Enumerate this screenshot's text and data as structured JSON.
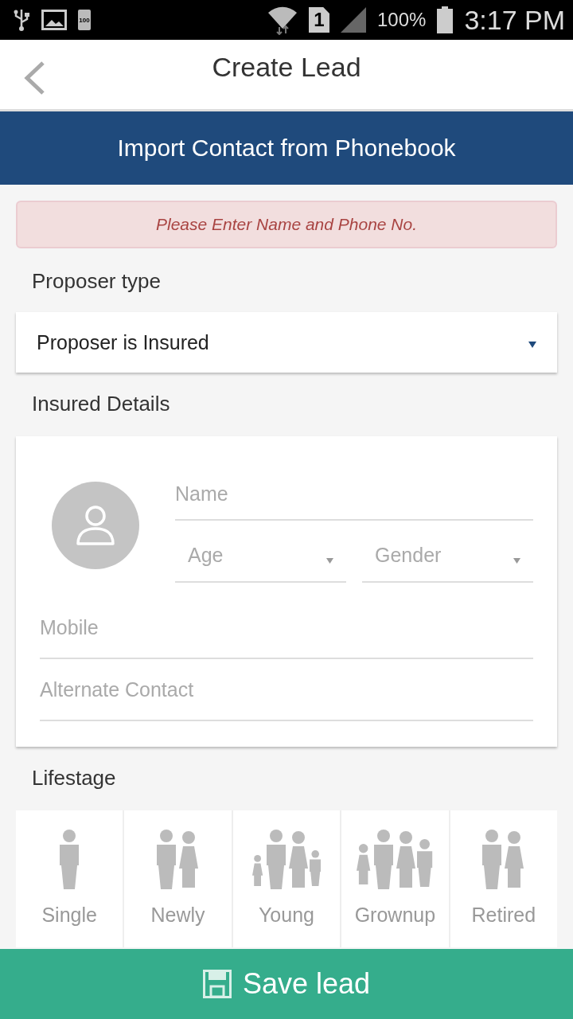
{
  "status_bar": {
    "notification_battery": "100",
    "sim": "1",
    "battery": "100%",
    "time": "3:17 PM"
  },
  "header": {
    "title": "Create Lead"
  },
  "import_button": "Import Contact from Phonebook",
  "alert": "Please Enter Name and Phone No.",
  "proposer": {
    "label": "Proposer type",
    "value": "Proposer is Insured"
  },
  "insured": {
    "label": "Insured Details",
    "name": {
      "placeholder": "Name"
    },
    "age": {
      "placeholder": "Age"
    },
    "gender": {
      "placeholder": "Gender"
    },
    "mobile": {
      "placeholder": "Mobile"
    },
    "alternate": {
      "placeholder": "Alternate Contact"
    }
  },
  "lifestage": {
    "label": "Lifestage",
    "options": [
      {
        "label": "Single",
        "kind": "single"
      },
      {
        "label": "Newly",
        "kind": "couple"
      },
      {
        "label": "Young",
        "kind": "young-family"
      },
      {
        "label": "Grownup",
        "kind": "grown-family"
      },
      {
        "label": "Retired",
        "kind": "couple"
      }
    ]
  },
  "save_button": "Save lead"
}
